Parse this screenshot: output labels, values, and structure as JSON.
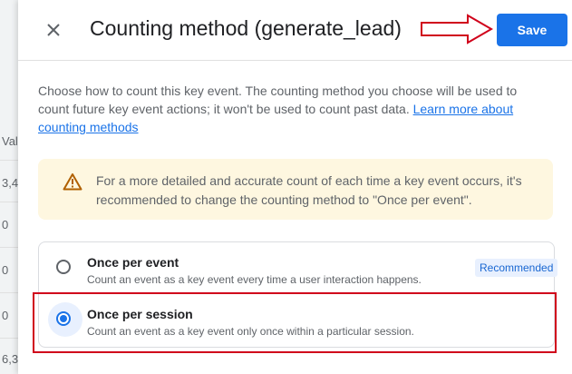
{
  "background": {
    "column_header": "Val",
    "cells": [
      "3,4",
      "0",
      "0",
      "0",
      "6,3"
    ]
  },
  "dialog": {
    "title": "Counting method (generate_lead)",
    "close_icon": "close-icon",
    "save_label": "Save",
    "description": "Choose how to count this key event. The counting method you choose will be used to count future key event actions; it won't be used to count past data.",
    "learn_more_link": "Learn more about counting methods",
    "warning": {
      "icon": "warning-triangle-icon",
      "text": "For a more detailed and accurate count of each time a key event occurs, it's recommended to change the counting method to \"Once per event\"."
    },
    "options": [
      {
        "label": "Once per event",
        "description": "Count an event as a key event every time a user interaction happens.",
        "badge": "Recommended",
        "selected": false
      },
      {
        "label": "Once per session",
        "description": "Count an event as a key event only once within a particular session.",
        "selected": true
      }
    ]
  },
  "annotations": {
    "arrow_color": "#d0021b",
    "highlight_color": "#d0021b"
  },
  "colors": {
    "accent": "#1a73e8",
    "warning_bg": "#fef7e0",
    "warning_icon": "#b06000"
  }
}
